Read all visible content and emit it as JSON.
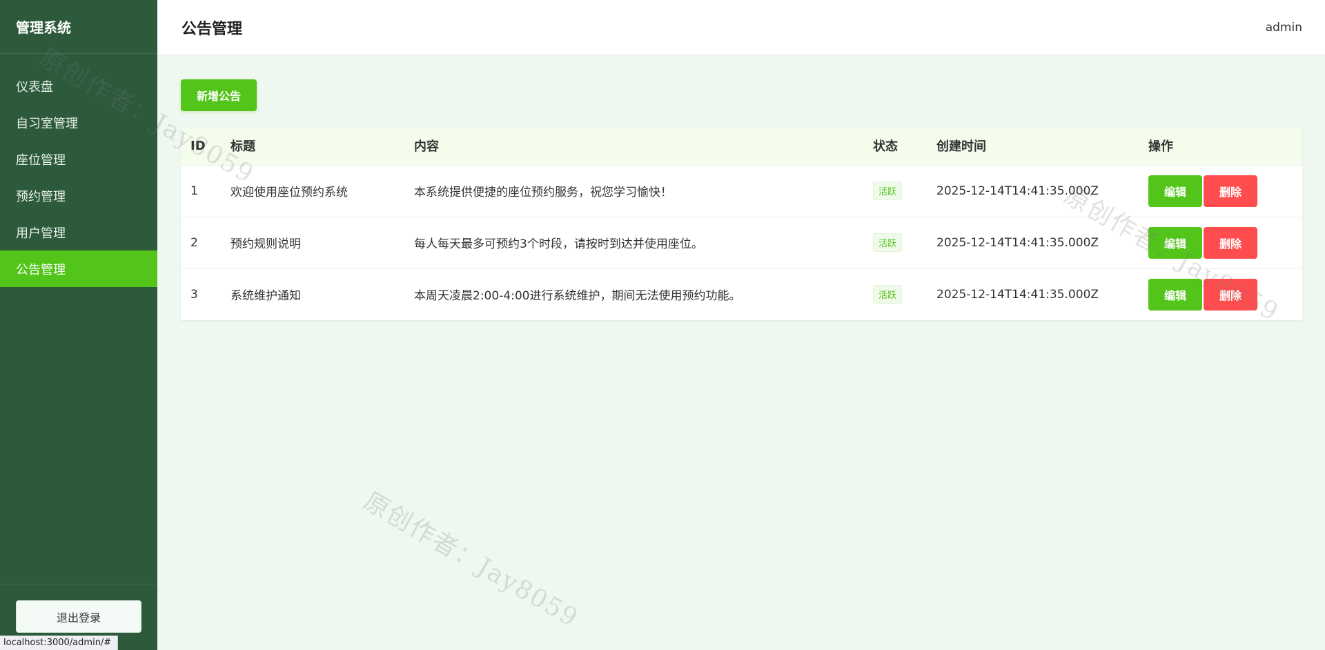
{
  "sidebar": {
    "brand": "管理系统",
    "items": [
      {
        "label": "仪表盘"
      },
      {
        "label": "自习室管理"
      },
      {
        "label": "座位管理"
      },
      {
        "label": "预约管理"
      },
      {
        "label": "用户管理"
      },
      {
        "label": "公告管理",
        "active": true
      }
    ],
    "logout_label": "退出登录"
  },
  "header": {
    "title": "公告管理",
    "username": "admin"
  },
  "toolbar": {
    "add_label": "新增公告"
  },
  "table": {
    "columns": [
      "ID",
      "标题",
      "内容",
      "状态",
      "创建时间",
      "操作"
    ],
    "rows": [
      {
        "id": "1",
        "title": "欢迎使用座位预约系统",
        "content": "本系统提供便捷的座位预约服务，祝您学习愉快！",
        "status": "活跃",
        "created": "2025-12-14T14:41:35.000Z"
      },
      {
        "id": "2",
        "title": "预约规则说明",
        "content": "每人每天最多可预约3个时段，请按时到达并使用座位。",
        "status": "活跃",
        "created": "2025-12-14T14:41:35.000Z"
      },
      {
        "id": "3",
        "title": "系统维护通知",
        "content": "本周天凌晨2:00-4:00进行系统维护，期间无法使用预约功能。",
        "status": "活跃",
        "created": "2025-12-14T14:41:35.000Z"
      }
    ],
    "edit_label": "编辑",
    "delete_label": "删除"
  },
  "watermark_text": "原创作者：Jay8059",
  "status_bar_url": "localhost:3000/admin/#",
  "colors": {
    "sidebar_bg": "#2c5a3b",
    "accent": "#52c41a",
    "danger": "#ff4d4f",
    "page_bg": "#eff7f1"
  }
}
